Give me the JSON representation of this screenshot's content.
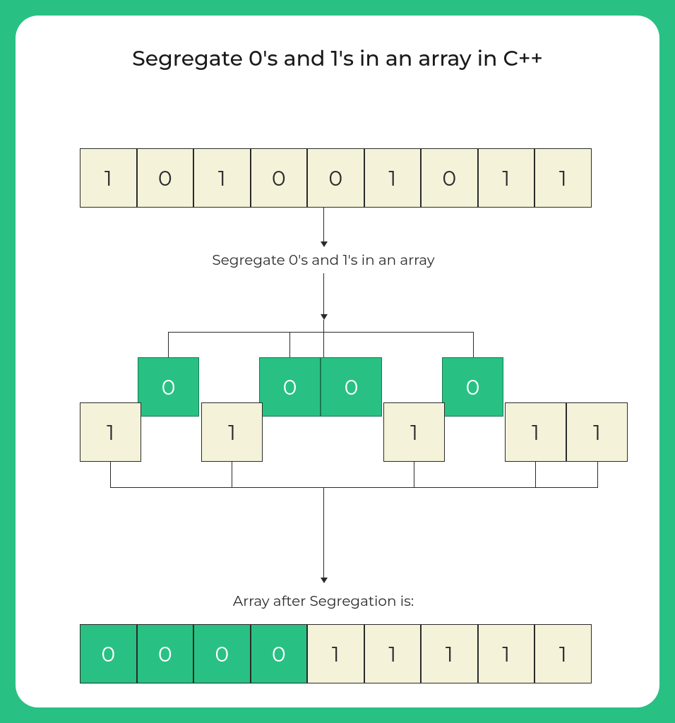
{
  "title": "Segregate 0's and 1's in an array in C++",
  "input_array": [
    "1",
    "0",
    "1",
    "0",
    "0",
    "1",
    "0",
    "1",
    "1"
  ],
  "mid_label": "Segregate 0's and 1's in an array",
  "split_zeros": [
    "0",
    "0",
    "0",
    "0"
  ],
  "split_ones": [
    "1",
    "1",
    "1",
    "1",
    "1"
  ],
  "middle_sequence": [
    {
      "v": "1",
      "t": "one"
    },
    {
      "v": "0",
      "t": "zero"
    },
    {
      "v": "1",
      "t": "one"
    },
    {
      "v": "0",
      "t": "zero"
    },
    {
      "v": "0",
      "t": "zero"
    },
    {
      "v": "1",
      "t": "one"
    },
    {
      "v": "0",
      "t": "zero"
    },
    {
      "v": "1",
      "t": "one"
    },
    {
      "v": "1",
      "t": "one"
    }
  ],
  "out_label": "Array after Segregation is:",
  "output_array": [
    {
      "v": "0",
      "c": "green"
    },
    {
      "v": "0",
      "c": "green"
    },
    {
      "v": "0",
      "c": "green"
    },
    {
      "v": "0",
      "c": "green"
    },
    {
      "v": "1",
      "c": "cream"
    },
    {
      "v": "1",
      "c": "cream"
    },
    {
      "v": "1",
      "c": "cream"
    },
    {
      "v": "1",
      "c": "cream"
    },
    {
      "v": "1",
      "c": "cream"
    }
  ]
}
